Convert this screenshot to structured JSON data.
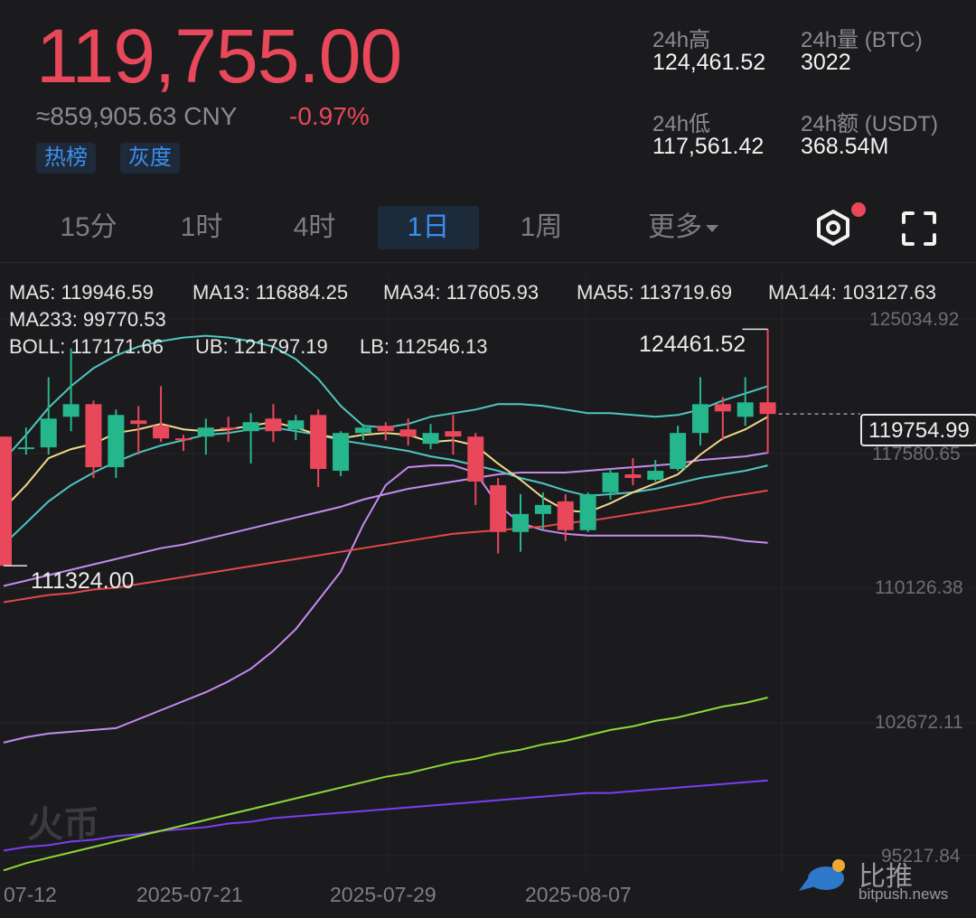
{
  "ticker": {
    "last_price": "119,755.00",
    "cny_equiv": "≈859,905.63 CNY",
    "change_pct": "-0.97%",
    "tags": [
      "热榜",
      "灰度"
    ]
  },
  "stats": {
    "high_label": "24h高",
    "high_value": "124,461.52",
    "low_label": "24h低",
    "low_value": "117,561.42",
    "vol_label": "24h量 (BTC)",
    "vol_value": "3022",
    "amt_label": "24h额 (USDT)",
    "amt_value": "368.54M"
  },
  "tabs": [
    {
      "label": "15分",
      "active": false
    },
    {
      "label": "1时",
      "active": false
    },
    {
      "label": "4时",
      "active": false
    },
    {
      "label": "1日",
      "active": true
    },
    {
      "label": "1周",
      "active": false
    },
    {
      "label": "更多",
      "active": false
    }
  ],
  "indicators": {
    "ma5": "MA5: 119946.59",
    "ma13": "MA13: 116884.25",
    "ma34": "MA34: 117605.93",
    "ma55": "MA55: 113719.69",
    "ma144": "MA144: 103127.63",
    "ma233": "MA233: 99770.53",
    "boll": "BOLL: 117171.66",
    "ub": "UB: 121797.19",
    "lb": "LB: 112546.13"
  },
  "colors": {
    "up": "#26b68c",
    "down": "#e9485a",
    "ma5": "#f3d98a",
    "ma13": "#4fc6c0",
    "ma34": "#c58bf2",
    "ma55": "#e64846",
    "ma144": "#8fd83a",
    "ma233": "#7a3ff0",
    "boll": "#f3d98a",
    "ub": "#4fc6c0",
    "lb": "#c58bf2"
  },
  "y_axis": [
    "125034.92",
    "117580.65",
    "110126.38",
    "102672.11",
    "95217.84"
  ],
  "x_axis": [
    "07-12",
    "2025-07-21",
    "2025-07-29",
    "2025-08-07"
  ],
  "markers": {
    "high": "124461.52",
    "low": "111324.00",
    "last": "119754.99"
  },
  "watermarks": {
    "exchange": "火币",
    "source_name": "比推",
    "source_url": "bitpush.news"
  },
  "chart_data": {
    "type": "candlestick",
    "candles": [
      {
        "o": 118500,
        "h": 118500,
        "l": 111324,
        "c": 111324
      },
      {
        "o": 117900,
        "h": 119000,
        "l": 117500,
        "c": 117900
      },
      {
        "o": 117900,
        "h": 121800,
        "l": 117500,
        "c": 119500
      },
      {
        "o": 119600,
        "h": 123400,
        "l": 118800,
        "c": 120300
      },
      {
        "o": 120300,
        "h": 120500,
        "l": 116200,
        "c": 116800
      },
      {
        "o": 116800,
        "h": 120000,
        "l": 116200,
        "c": 119700
      },
      {
        "o": 119400,
        "h": 120200,
        "l": 117500,
        "c": 119200
      },
      {
        "o": 119100,
        "h": 121300,
        "l": 118200,
        "c": 118400
      },
      {
        "o": 118400,
        "h": 118600,
        "l": 117700,
        "c": 118300
      },
      {
        "o": 118500,
        "h": 119500,
        "l": 117500,
        "c": 119000
      },
      {
        "o": 119000,
        "h": 119600,
        "l": 118200,
        "c": 118900
      },
      {
        "o": 118800,
        "h": 119800,
        "l": 117000,
        "c": 119300
      },
      {
        "o": 119500,
        "h": 120300,
        "l": 118200,
        "c": 118800
      },
      {
        "o": 118900,
        "h": 119700,
        "l": 118300,
        "c": 119400
      },
      {
        "o": 119700,
        "h": 120000,
        "l": 115700,
        "c": 116700
      },
      {
        "o": 116600,
        "h": 118800,
        "l": 116300,
        "c": 118700
      },
      {
        "o": 118700,
        "h": 119200,
        "l": 118300,
        "c": 119000
      },
      {
        "o": 119100,
        "h": 119300,
        "l": 118300,
        "c": 118800
      },
      {
        "o": 118900,
        "h": 119500,
        "l": 118000,
        "c": 118500
      },
      {
        "o": 118100,
        "h": 119200,
        "l": 117800,
        "c": 118700
      },
      {
        "o": 118800,
        "h": 119700,
        "l": 117500,
        "c": 118500
      },
      {
        "o": 118500,
        "h": 118700,
        "l": 114700,
        "c": 116000
      },
      {
        "o": 115800,
        "h": 116200,
        "l": 112000,
        "c": 113200
      },
      {
        "o": 113200,
        "h": 115300,
        "l": 112100,
        "c": 114200
      },
      {
        "o": 114200,
        "h": 115400,
        "l": 113300,
        "c": 114700
      },
      {
        "o": 114900,
        "h": 115300,
        "l": 112700,
        "c": 113300
      },
      {
        "o": 113300,
        "h": 115400,
        "l": 113200,
        "c": 115300
      },
      {
        "o": 115400,
        "h": 116700,
        "l": 115000,
        "c": 116500
      },
      {
        "o": 116400,
        "h": 117300,
        "l": 115800,
        "c": 116200
      },
      {
        "o": 116100,
        "h": 117200,
        "l": 116000,
        "c": 116600
      },
      {
        "o": 116700,
        "h": 119100,
        "l": 116600,
        "c": 118700
      },
      {
        "o": 118700,
        "h": 121800,
        "l": 118000,
        "c": 120300
      },
      {
        "o": 120300,
        "h": 120700,
        "l": 118300,
        "c": 119900
      },
      {
        "o": 119600,
        "h": 121800,
        "l": 119100,
        "c": 120400
      },
      {
        "o": 120400,
        "h": 124461.52,
        "l": 117561.42,
        "c": 119754.99
      }
    ],
    "lines": {
      "ma5": [
        114500,
        115800,
        117300,
        117800,
        118100,
        118700,
        118900,
        119200,
        118900,
        118800,
        118900,
        119100,
        119300,
        119000,
        118600,
        118400,
        118600,
        118700,
        118600,
        118200,
        118300,
        118000,
        117000,
        116100,
        115100,
        114400,
        114300,
        114800,
        115400,
        115900,
        116400,
        117500,
        118400,
        118900,
        119600
      ],
      "ma13": [
        112500,
        113700,
        114900,
        115800,
        116500,
        117100,
        117600,
        118000,
        118300,
        118600,
        118700,
        118900,
        119000,
        118800,
        118600,
        118300,
        118100,
        117900,
        117700,
        117400,
        117200,
        116900,
        116600,
        116200,
        115900,
        115500,
        115200,
        115300,
        115400,
        115600,
        115900,
        116200,
        116400,
        116600,
        116900
      ],
      "ma34": [
        110200,
        110500,
        110800,
        111100,
        111400,
        111700,
        112000,
        112300,
        112500,
        112800,
        113100,
        113400,
        113700,
        114000,
        114300,
        114600,
        115000,
        115300,
        115600,
        115800,
        116000,
        116200,
        116400,
        116500,
        116500,
        116500,
        116600,
        116700,
        116800,
        116900,
        117000,
        117200,
        117300,
        117400,
        117600
      ],
      "ma55": [
        109300,
        109500,
        109700,
        109800,
        110000,
        110100,
        110300,
        110500,
        110700,
        110900,
        111100,
        111300,
        111500,
        111700,
        111900,
        112100,
        112300,
        112500,
        112700,
        112900,
        113100,
        113200,
        113300,
        113400,
        113500,
        113700,
        113800,
        114000,
        114200,
        114400,
        114600,
        114800,
        115100,
        115300,
        115500
      ],
      "ma144": [
        94400,
        94800,
        95100,
        95400,
        95700,
        96000,
        96300,
        96600,
        96900,
        97200,
        97500,
        97800,
        98100,
        98400,
        98700,
        99000,
        99300,
        99600,
        99800,
        100100,
        100400,
        100600,
        100900,
        101100,
        101400,
        101600,
        101900,
        102200,
        102400,
        102700,
        102900,
        103200,
        103500,
        103700,
        104000
      ],
      "ma233": [
        95500,
        95700,
        95800,
        96000,
        96100,
        96300,
        96400,
        96600,
        96700,
        96800,
        97000,
        97100,
        97300,
        97400,
        97500,
        97600,
        97700,
        97800,
        97900,
        98000,
        98100,
        98200,
        98300,
        98400,
        98500,
        98600,
        98700,
        98700,
        98800,
        98900,
        99000,
        99100,
        99200,
        99300,
        99400
      ],
      "ub": [
        117200,
        118600,
        120100,
        121300,
        122300,
        123000,
        123500,
        123800,
        124000,
        124100,
        124000,
        123800,
        123500,
        122800,
        121700,
        120200,
        119100,
        119000,
        119200,
        119600,
        119800,
        120000,
        120300,
        120300,
        120200,
        120000,
        119800,
        119800,
        119700,
        119600,
        119700,
        120000,
        120500,
        120900,
        121300
      ],
      "lb": [
        101500,
        101800,
        102000,
        102100,
        102200,
        102300,
        102800,
        103300,
        103800,
        104300,
        104900,
        105600,
        106600,
        107800,
        109400,
        111000,
        113600,
        115800,
        116800,
        116900,
        116900,
        116500,
        114700,
        113700,
        113300,
        113100,
        113000,
        113000,
        113000,
        113000,
        113000,
        113000,
        112900,
        112700,
        112600
      ]
    },
    "y_ticks": [
      125034.92,
      117580.65,
      110126.38,
      102672.11,
      95217.84
    ],
    "x_ticks": [
      "07-12",
      "2025-07-21",
      "2025-07-29",
      "2025-08-07"
    ]
  }
}
